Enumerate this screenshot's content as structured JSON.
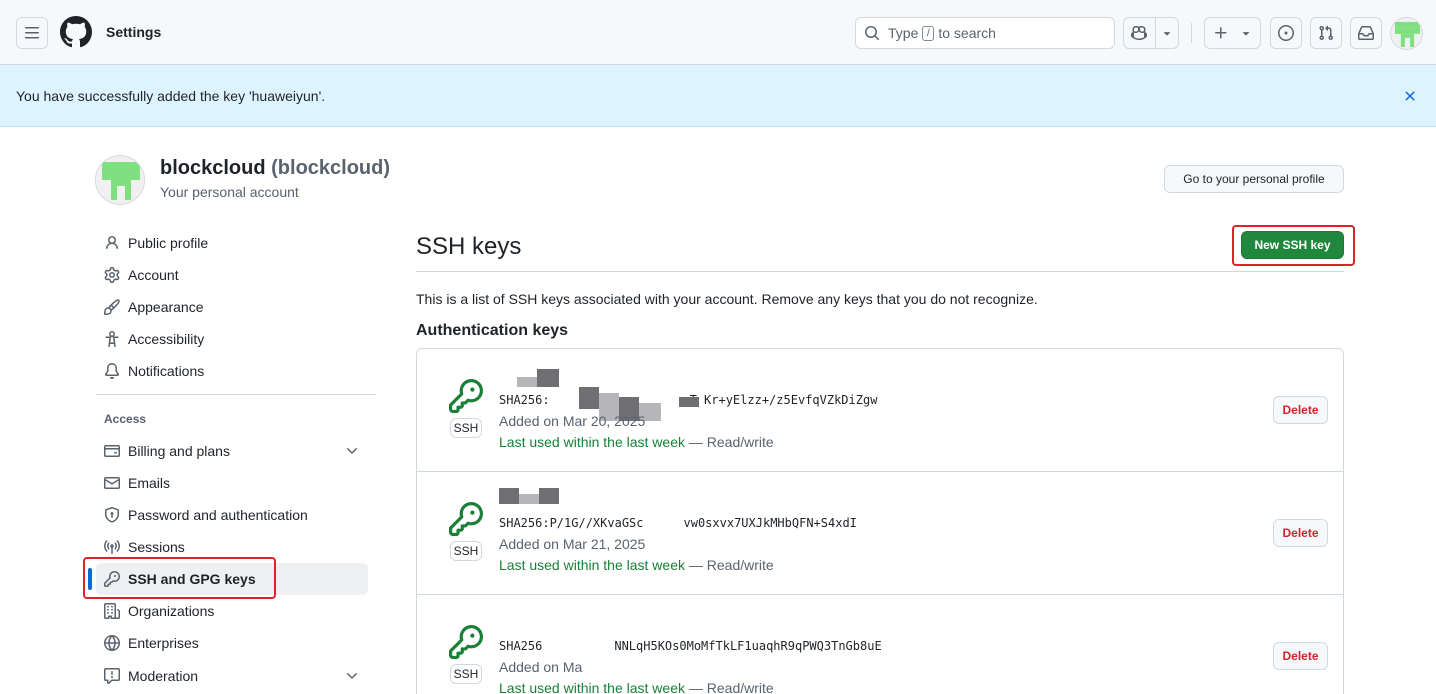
{
  "header": {
    "title": "Settings",
    "search_prefix": "Type",
    "search_key": "/",
    "search_suffix": "to search"
  },
  "flash": {
    "message": "You have successfully added the key 'huaweiyun'."
  },
  "profile": {
    "name": "blockcloud",
    "login": "(blockcloud)",
    "subtitle": "Your personal account",
    "go_profile_label": "Go to your personal profile"
  },
  "sidebar": {
    "items": [
      {
        "label": "Public profile",
        "icon": "person-icon"
      },
      {
        "label": "Account",
        "icon": "gear-icon"
      },
      {
        "label": "Appearance",
        "icon": "paintbrush-icon"
      },
      {
        "label": "Accessibility",
        "icon": "accessibility-icon"
      },
      {
        "label": "Notifications",
        "icon": "bell-icon"
      }
    ],
    "access_heading": "Access",
    "access_items": [
      {
        "label": "Billing and plans",
        "icon": "credit-card-icon"
      },
      {
        "label": "Emails",
        "icon": "mail-icon"
      },
      {
        "label": "Password and authentication",
        "icon": "shield-lock-icon"
      },
      {
        "label": "Sessions",
        "icon": "broadcast-icon"
      },
      {
        "label": "SSH and GPG keys",
        "icon": "key-icon"
      },
      {
        "label": "Organizations",
        "icon": "organization-icon"
      },
      {
        "label": "Enterprises",
        "icon": "globe-icon"
      },
      {
        "label": "Moderation",
        "icon": "report-icon"
      }
    ]
  },
  "main": {
    "title": "SSH keys",
    "new_key_label": "New SSH key",
    "description": "This is a list of SSH keys associated with your account. Remove any keys that you do not recognize.",
    "auth_heading": "Authentication keys",
    "keys": [
      {
        "tag": "SSH",
        "fingerprint": "SHA256:5..............RT.W..yKr+yElzz+/z5EvfqVZkDiZgw",
        "fingerprint_visible": "SHA256:",
        "fingerprint_tail": "T Kr+yElzz+/z5EvfqVZkDiZgw",
        "added": "Added on Mar 20, 2025",
        "used": "Last used within the last week",
        "access": " — Read/write",
        "delete_label": "Delete"
      },
      {
        "tag": "SSH",
        "fingerprint_visible": "SHA256:P/1G//XKvaGSc",
        "fingerprint_tail": "vw0sxvx7UXJkMHbQFN+S4xdI",
        "added": "Added on Mar 21, 2025",
        "used": "Last used within the last week",
        "access": " — Read/write",
        "delete_label": "Delete"
      },
      {
        "tag": "SSH",
        "fingerprint_visible": "SHA256",
        "fingerprint_tail": "NNLqH5KOs0MoMfTkLF1uaqhR9qPWQ3TnGb8uE",
        "added": "Added on Ma",
        "used": "Last used within the last week",
        "access": " — Read/write",
        "delete_label": "Delete"
      }
    ]
  },
  "colors": {
    "accent_green": "#1f883d",
    "success_text": "#1a7f37",
    "danger": "#d1242f",
    "flash_bg": "#ddf4ff",
    "active_bar": "#0969da",
    "highlight": "#e0212b"
  }
}
